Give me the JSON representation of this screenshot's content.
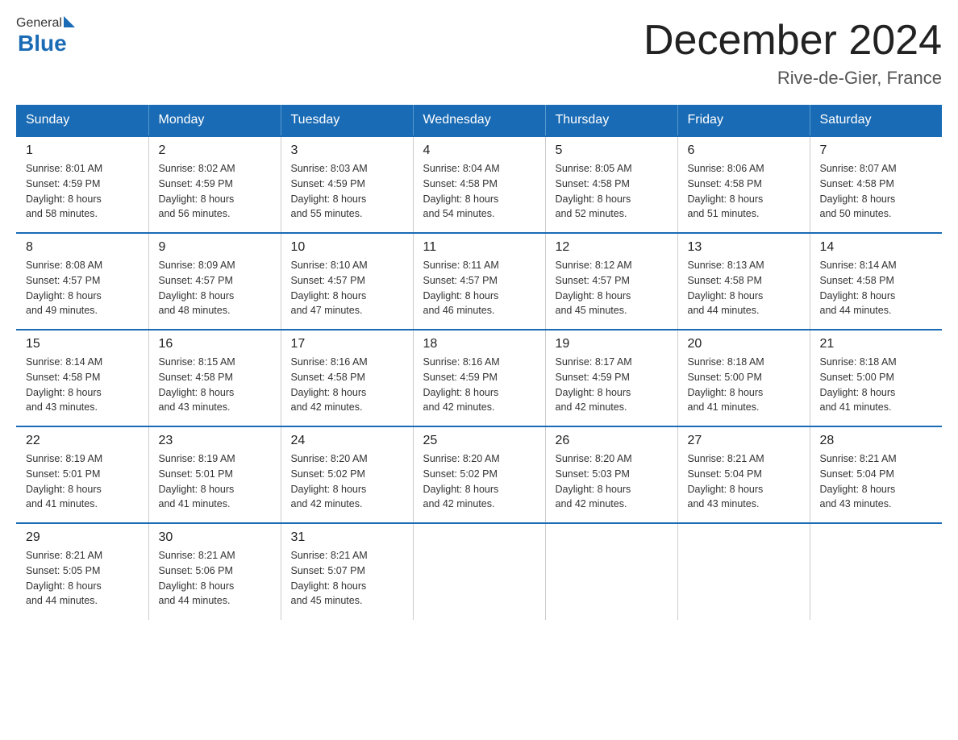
{
  "header": {
    "logo_general": "General",
    "logo_blue": "Blue",
    "month_title": "December 2024",
    "location": "Rive-de-Gier, France"
  },
  "days_of_week": [
    "Sunday",
    "Monday",
    "Tuesday",
    "Wednesday",
    "Thursday",
    "Friday",
    "Saturday"
  ],
  "weeks": [
    [
      {
        "day": "1",
        "sunrise": "8:01 AM",
        "sunset": "4:59 PM",
        "daylight": "8 hours and 58 minutes."
      },
      {
        "day": "2",
        "sunrise": "8:02 AM",
        "sunset": "4:59 PM",
        "daylight": "8 hours and 56 minutes."
      },
      {
        "day": "3",
        "sunrise": "8:03 AM",
        "sunset": "4:59 PM",
        "daylight": "8 hours and 55 minutes."
      },
      {
        "day": "4",
        "sunrise": "8:04 AM",
        "sunset": "4:58 PM",
        "daylight": "8 hours and 54 minutes."
      },
      {
        "day": "5",
        "sunrise": "8:05 AM",
        "sunset": "4:58 PM",
        "daylight": "8 hours and 52 minutes."
      },
      {
        "day": "6",
        "sunrise": "8:06 AM",
        "sunset": "4:58 PM",
        "daylight": "8 hours and 51 minutes."
      },
      {
        "day": "7",
        "sunrise": "8:07 AM",
        "sunset": "4:58 PM",
        "daylight": "8 hours and 50 minutes."
      }
    ],
    [
      {
        "day": "8",
        "sunrise": "8:08 AM",
        "sunset": "4:57 PM",
        "daylight": "8 hours and 49 minutes."
      },
      {
        "day": "9",
        "sunrise": "8:09 AM",
        "sunset": "4:57 PM",
        "daylight": "8 hours and 48 minutes."
      },
      {
        "day": "10",
        "sunrise": "8:10 AM",
        "sunset": "4:57 PM",
        "daylight": "8 hours and 47 minutes."
      },
      {
        "day": "11",
        "sunrise": "8:11 AM",
        "sunset": "4:57 PM",
        "daylight": "8 hours and 46 minutes."
      },
      {
        "day": "12",
        "sunrise": "8:12 AM",
        "sunset": "4:57 PM",
        "daylight": "8 hours and 45 minutes."
      },
      {
        "day": "13",
        "sunrise": "8:13 AM",
        "sunset": "4:58 PM",
        "daylight": "8 hours and 44 minutes."
      },
      {
        "day": "14",
        "sunrise": "8:14 AM",
        "sunset": "4:58 PM",
        "daylight": "8 hours and 44 minutes."
      }
    ],
    [
      {
        "day": "15",
        "sunrise": "8:14 AM",
        "sunset": "4:58 PM",
        "daylight": "8 hours and 43 minutes."
      },
      {
        "day": "16",
        "sunrise": "8:15 AM",
        "sunset": "4:58 PM",
        "daylight": "8 hours and 43 minutes."
      },
      {
        "day": "17",
        "sunrise": "8:16 AM",
        "sunset": "4:58 PM",
        "daylight": "8 hours and 42 minutes."
      },
      {
        "day": "18",
        "sunrise": "8:16 AM",
        "sunset": "4:59 PM",
        "daylight": "8 hours and 42 minutes."
      },
      {
        "day": "19",
        "sunrise": "8:17 AM",
        "sunset": "4:59 PM",
        "daylight": "8 hours and 42 minutes."
      },
      {
        "day": "20",
        "sunrise": "8:18 AM",
        "sunset": "5:00 PM",
        "daylight": "8 hours and 41 minutes."
      },
      {
        "day": "21",
        "sunrise": "8:18 AM",
        "sunset": "5:00 PM",
        "daylight": "8 hours and 41 minutes."
      }
    ],
    [
      {
        "day": "22",
        "sunrise": "8:19 AM",
        "sunset": "5:01 PM",
        "daylight": "8 hours and 41 minutes."
      },
      {
        "day": "23",
        "sunrise": "8:19 AM",
        "sunset": "5:01 PM",
        "daylight": "8 hours and 41 minutes."
      },
      {
        "day": "24",
        "sunrise": "8:20 AM",
        "sunset": "5:02 PM",
        "daylight": "8 hours and 42 minutes."
      },
      {
        "day": "25",
        "sunrise": "8:20 AM",
        "sunset": "5:02 PM",
        "daylight": "8 hours and 42 minutes."
      },
      {
        "day": "26",
        "sunrise": "8:20 AM",
        "sunset": "5:03 PM",
        "daylight": "8 hours and 42 minutes."
      },
      {
        "day": "27",
        "sunrise": "8:21 AM",
        "sunset": "5:04 PM",
        "daylight": "8 hours and 43 minutes."
      },
      {
        "day": "28",
        "sunrise": "8:21 AM",
        "sunset": "5:04 PM",
        "daylight": "8 hours and 43 minutes."
      }
    ],
    [
      {
        "day": "29",
        "sunrise": "8:21 AM",
        "sunset": "5:05 PM",
        "daylight": "8 hours and 44 minutes."
      },
      {
        "day": "30",
        "sunrise": "8:21 AM",
        "sunset": "5:06 PM",
        "daylight": "8 hours and 44 minutes."
      },
      {
        "day": "31",
        "sunrise": "8:21 AM",
        "sunset": "5:07 PM",
        "daylight": "8 hours and 45 minutes."
      },
      null,
      null,
      null,
      null
    ]
  ],
  "labels": {
    "sunrise": "Sunrise:",
    "sunset": "Sunset:",
    "daylight": "Daylight:"
  }
}
